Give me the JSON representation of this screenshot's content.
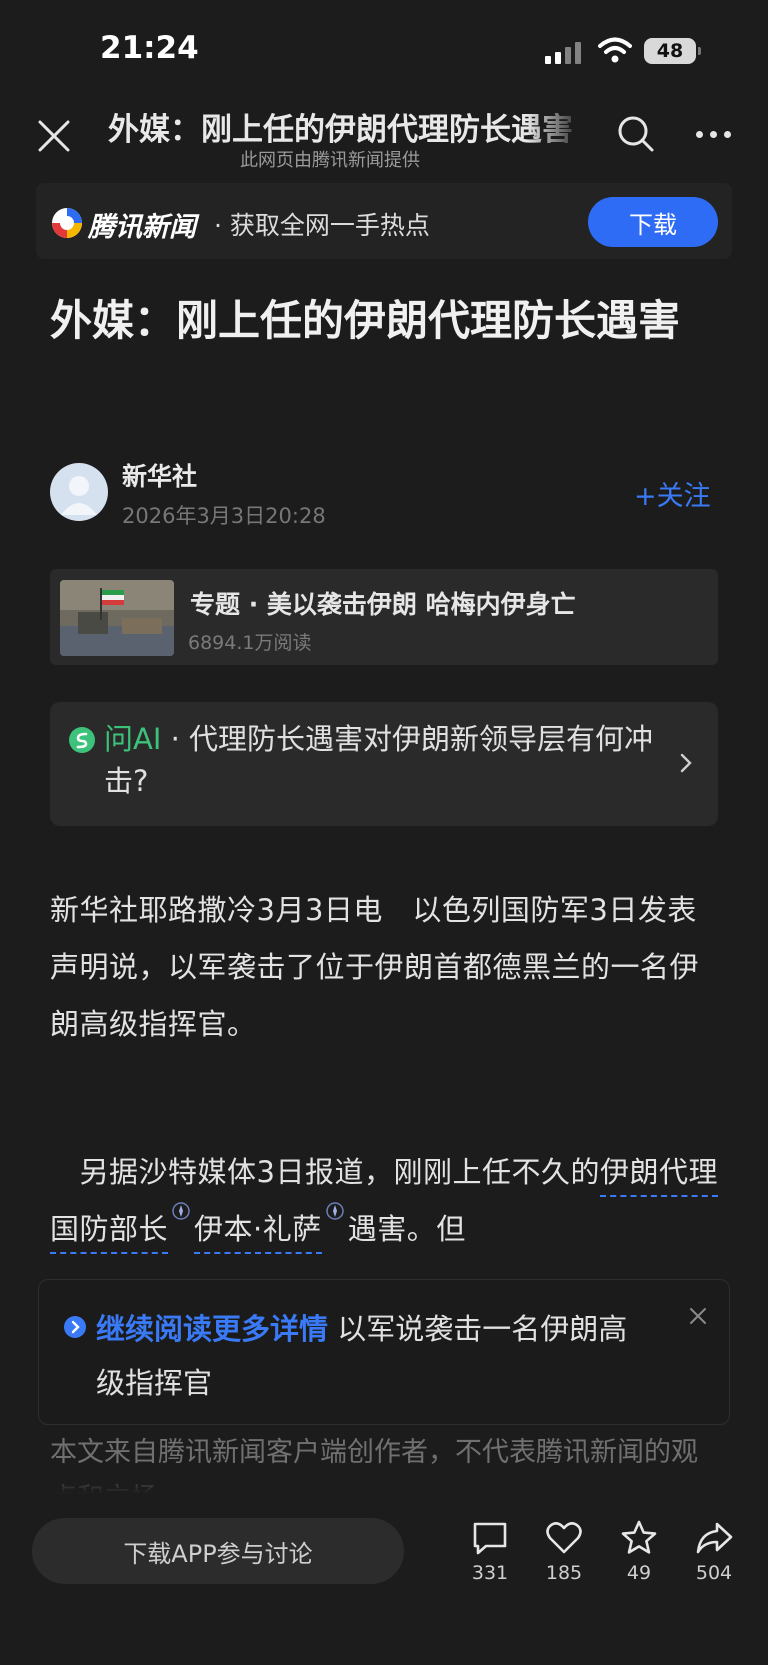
{
  "status_bar": {
    "time": "21:24",
    "battery": "48"
  },
  "nav": {
    "title": "外媒：刚上任的伊朗代理防长遇害",
    "subtitle": "此网页由腾讯新闻提供"
  },
  "banner": {
    "logo": "腾讯新闻",
    "slogan": "· 获取全网一手热点",
    "download": "下载"
  },
  "article": {
    "headline": "外媒：刚上任的伊朗代理防长遇害",
    "author": "新华社",
    "date": "2026年3月3日20:28",
    "follow": "+关注"
  },
  "topic": {
    "title": "专题 · 美以袭击伊朗 哈梅内伊身亡",
    "reads": "6894.1万阅读"
  },
  "ask_ai": {
    "label": "问AI",
    "question": " · 代理防长遇害对伊朗新领导层有何冲击?"
  },
  "body": {
    "p1": "新华社耶路撒冷3月3日电　以色列国防军3日发表声明说，以军袭击了位于伊朗首都德黑兰的一名伊朗高级指挥官。",
    "p2_lead": "　另据沙特媒体3日报道，刚刚上任不久的",
    "p2_entity1": "伊朗代理国防部长",
    "p2_entity2": "伊本·礼萨",
    "p2_tail": "遇害。但"
  },
  "continue": {
    "link": "继续阅读更多详情",
    "text": " 以军说袭击一名伊朗高级指挥官"
  },
  "disclaimer": "本文来自腾讯新闻客户端创作者，不代表腾讯新闻的观点和立场",
  "bottom": {
    "discuss": "下载APP参与讨论",
    "comments": "331",
    "likes": "185",
    "favorites": "49",
    "shares": "504"
  },
  "colors": {
    "accent": "#3a7af6",
    "button": "#2f6cf6",
    "ai_green": "#3cc27a",
    "background": "#1c1c1c"
  }
}
